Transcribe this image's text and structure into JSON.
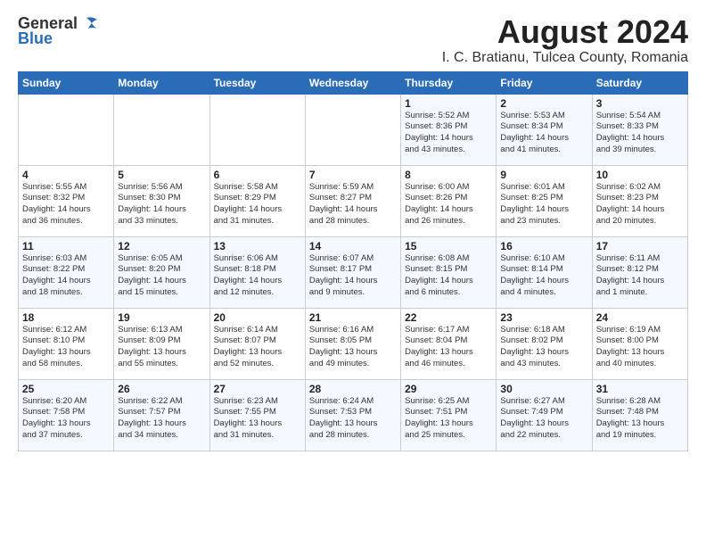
{
  "logo": {
    "general": "General",
    "blue": "Blue"
  },
  "title": "August 2024",
  "location": "I. C. Bratianu, Tulcea County, Romania",
  "days_of_week": [
    "Sunday",
    "Monday",
    "Tuesday",
    "Wednesday",
    "Thursday",
    "Friday",
    "Saturday"
  ],
  "weeks": [
    [
      {
        "day": "",
        "info": ""
      },
      {
        "day": "",
        "info": ""
      },
      {
        "day": "",
        "info": ""
      },
      {
        "day": "",
        "info": ""
      },
      {
        "day": "1",
        "info": "Sunrise: 5:52 AM\nSunset: 8:36 PM\nDaylight: 14 hours\nand 43 minutes."
      },
      {
        "day": "2",
        "info": "Sunrise: 5:53 AM\nSunset: 8:34 PM\nDaylight: 14 hours\nand 41 minutes."
      },
      {
        "day": "3",
        "info": "Sunrise: 5:54 AM\nSunset: 8:33 PM\nDaylight: 14 hours\nand 39 minutes."
      }
    ],
    [
      {
        "day": "4",
        "info": "Sunrise: 5:55 AM\nSunset: 8:32 PM\nDaylight: 14 hours\nand 36 minutes."
      },
      {
        "day": "5",
        "info": "Sunrise: 5:56 AM\nSunset: 8:30 PM\nDaylight: 14 hours\nand 33 minutes."
      },
      {
        "day": "6",
        "info": "Sunrise: 5:58 AM\nSunset: 8:29 PM\nDaylight: 14 hours\nand 31 minutes."
      },
      {
        "day": "7",
        "info": "Sunrise: 5:59 AM\nSunset: 8:27 PM\nDaylight: 14 hours\nand 28 minutes."
      },
      {
        "day": "8",
        "info": "Sunrise: 6:00 AM\nSunset: 8:26 PM\nDaylight: 14 hours\nand 26 minutes."
      },
      {
        "day": "9",
        "info": "Sunrise: 6:01 AM\nSunset: 8:25 PM\nDaylight: 14 hours\nand 23 minutes."
      },
      {
        "day": "10",
        "info": "Sunrise: 6:02 AM\nSunset: 8:23 PM\nDaylight: 14 hours\nand 20 minutes."
      }
    ],
    [
      {
        "day": "11",
        "info": "Sunrise: 6:03 AM\nSunset: 8:22 PM\nDaylight: 14 hours\nand 18 minutes."
      },
      {
        "day": "12",
        "info": "Sunrise: 6:05 AM\nSunset: 8:20 PM\nDaylight: 14 hours\nand 15 minutes."
      },
      {
        "day": "13",
        "info": "Sunrise: 6:06 AM\nSunset: 8:18 PM\nDaylight: 14 hours\nand 12 minutes."
      },
      {
        "day": "14",
        "info": "Sunrise: 6:07 AM\nSunset: 8:17 PM\nDaylight: 14 hours\nand 9 minutes."
      },
      {
        "day": "15",
        "info": "Sunrise: 6:08 AM\nSunset: 8:15 PM\nDaylight: 14 hours\nand 6 minutes."
      },
      {
        "day": "16",
        "info": "Sunrise: 6:10 AM\nSunset: 8:14 PM\nDaylight: 14 hours\nand 4 minutes."
      },
      {
        "day": "17",
        "info": "Sunrise: 6:11 AM\nSunset: 8:12 PM\nDaylight: 14 hours\nand 1 minute."
      }
    ],
    [
      {
        "day": "18",
        "info": "Sunrise: 6:12 AM\nSunset: 8:10 PM\nDaylight: 13 hours\nand 58 minutes."
      },
      {
        "day": "19",
        "info": "Sunrise: 6:13 AM\nSunset: 8:09 PM\nDaylight: 13 hours\nand 55 minutes."
      },
      {
        "day": "20",
        "info": "Sunrise: 6:14 AM\nSunset: 8:07 PM\nDaylight: 13 hours\nand 52 minutes."
      },
      {
        "day": "21",
        "info": "Sunrise: 6:16 AM\nSunset: 8:05 PM\nDaylight: 13 hours\nand 49 minutes."
      },
      {
        "day": "22",
        "info": "Sunrise: 6:17 AM\nSunset: 8:04 PM\nDaylight: 13 hours\nand 46 minutes."
      },
      {
        "day": "23",
        "info": "Sunrise: 6:18 AM\nSunset: 8:02 PM\nDaylight: 13 hours\nand 43 minutes."
      },
      {
        "day": "24",
        "info": "Sunrise: 6:19 AM\nSunset: 8:00 PM\nDaylight: 13 hours\nand 40 minutes."
      }
    ],
    [
      {
        "day": "25",
        "info": "Sunrise: 6:20 AM\nSunset: 7:58 PM\nDaylight: 13 hours\nand 37 minutes."
      },
      {
        "day": "26",
        "info": "Sunrise: 6:22 AM\nSunset: 7:57 PM\nDaylight: 13 hours\nand 34 minutes."
      },
      {
        "day": "27",
        "info": "Sunrise: 6:23 AM\nSunset: 7:55 PM\nDaylight: 13 hours\nand 31 minutes."
      },
      {
        "day": "28",
        "info": "Sunrise: 6:24 AM\nSunset: 7:53 PM\nDaylight: 13 hours\nand 28 minutes."
      },
      {
        "day": "29",
        "info": "Sunrise: 6:25 AM\nSunset: 7:51 PM\nDaylight: 13 hours\nand 25 minutes."
      },
      {
        "day": "30",
        "info": "Sunrise: 6:27 AM\nSunset: 7:49 PM\nDaylight: 13 hours\nand 22 minutes."
      },
      {
        "day": "31",
        "info": "Sunrise: 6:28 AM\nSunset: 7:48 PM\nDaylight: 13 hours\nand 19 minutes."
      }
    ]
  ]
}
